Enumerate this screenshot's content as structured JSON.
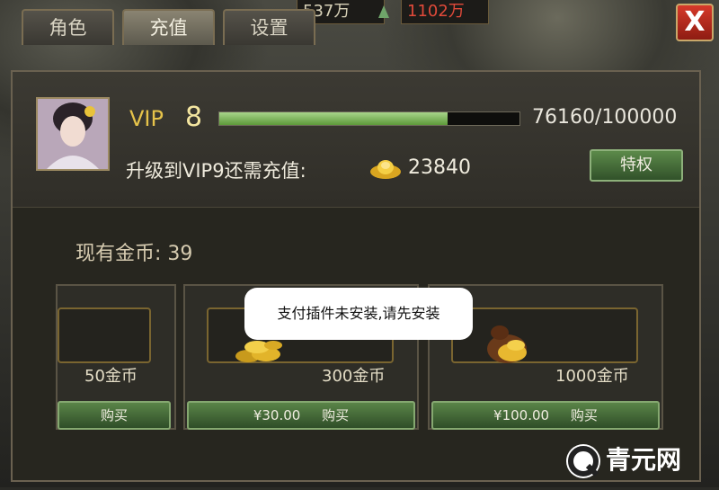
{
  "top_resources": {
    "res1": "537万",
    "res2": "1102万"
  },
  "tabs": [
    {
      "label": "角色",
      "active": false
    },
    {
      "label": "充值",
      "active": true
    },
    {
      "label": "设置",
      "active": false
    }
  ],
  "close": {
    "label": "X"
  },
  "vip": {
    "label": "VIP",
    "level": "8",
    "progress_text": "76160/100000",
    "progress_fraction": 0.7616,
    "upgrade_text": "升级到VIP9还需充值:",
    "upgrade_amount": "23840",
    "privilege_label": "特权"
  },
  "gold": {
    "current": "现有金币: 39"
  },
  "cards": [
    {
      "amount": "50金币",
      "buy": "购买"
    },
    {
      "amount": "300金币",
      "price": "¥30.00",
      "buy": "购买"
    },
    {
      "amount": "1000金币",
      "price": "¥100.00",
      "buy": "购买"
    }
  ],
  "toast": {
    "text": "支付插件未安装,请先安装"
  },
  "watermark": {
    "text": "青元网"
  },
  "colors": {
    "accent_gold": "#e6c34a",
    "button_green": "#5c8a4a",
    "close_red": "#d6392a"
  }
}
